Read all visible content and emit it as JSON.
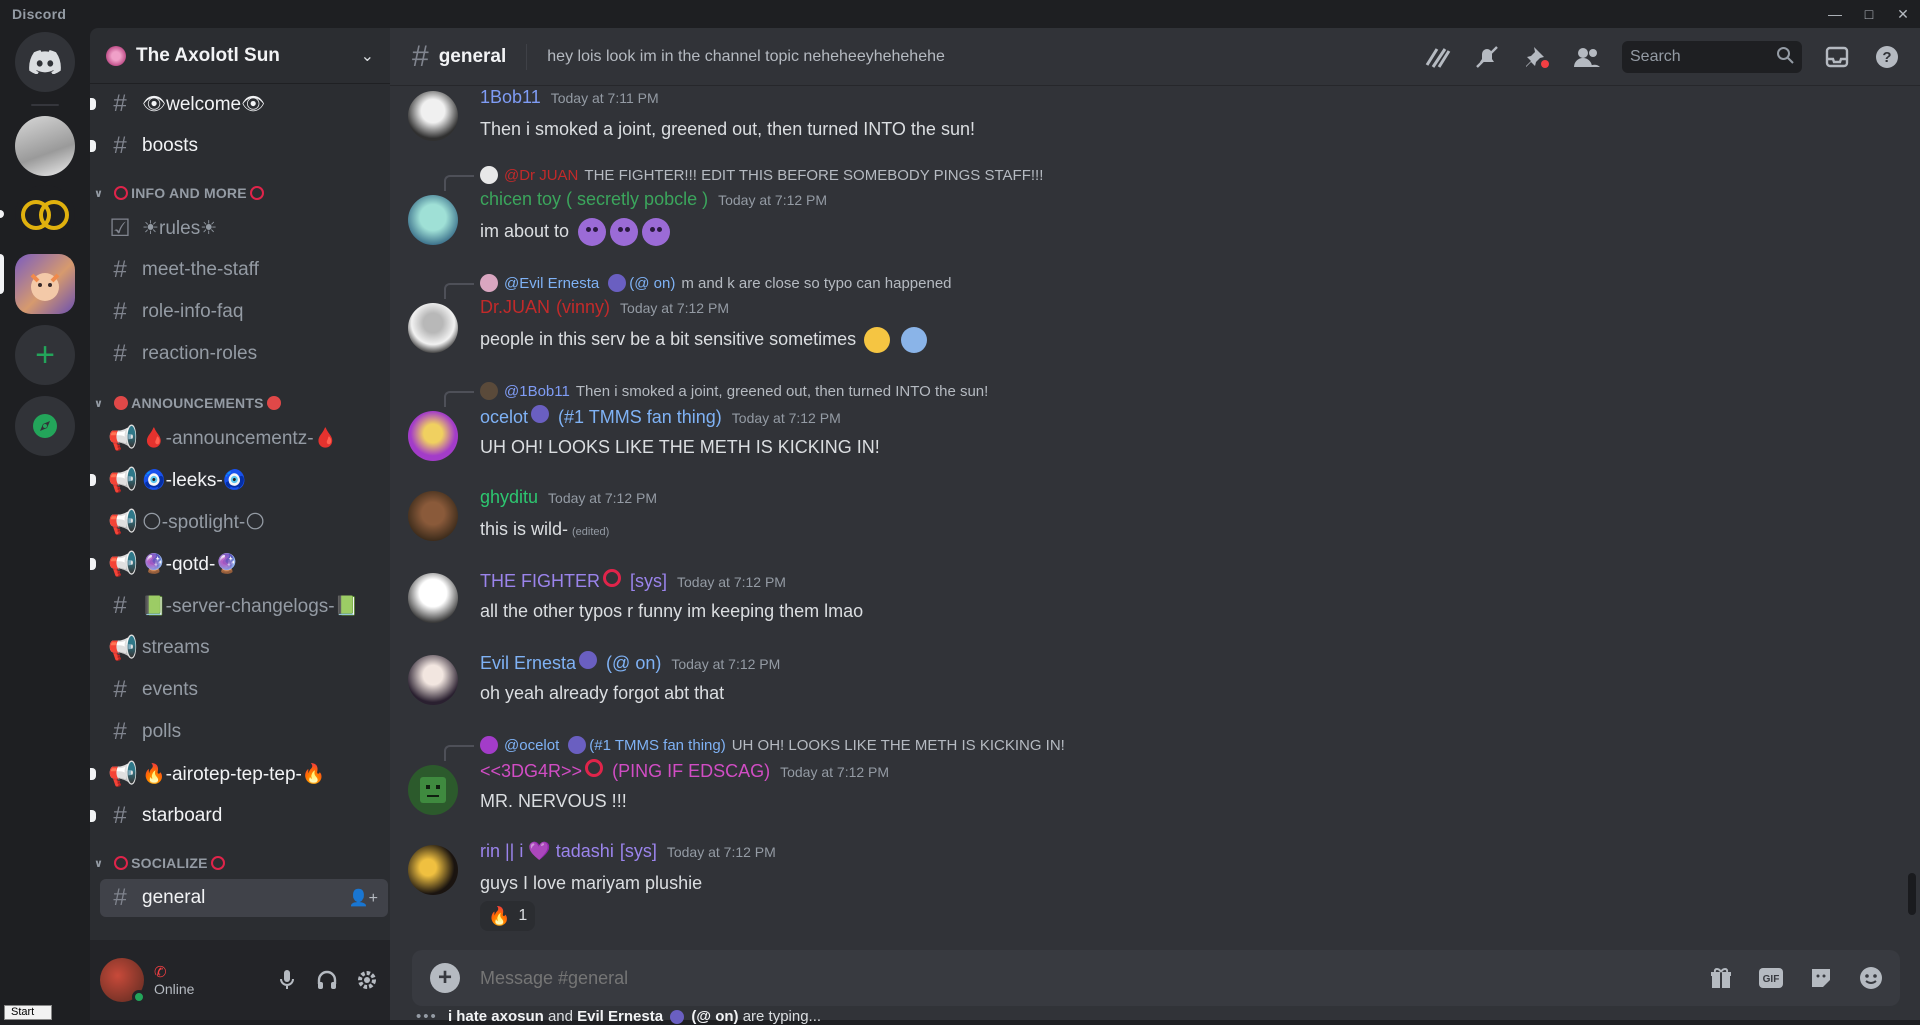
{
  "app": {
    "title": "Discord"
  },
  "guild": {
    "name": "The Axolotl Sun"
  },
  "sidebar": {
    "channels": [
      {
        "label": "👁welcome👁",
        "icon": "hash",
        "unread": true
      },
      {
        "label": "boosts",
        "icon": "hash",
        "unread": true
      }
    ],
    "cat_info": "INFO AND MORE",
    "info_channels": [
      {
        "label": "☀rules☀",
        "icon": "rules"
      },
      {
        "label": "meet-the-staff",
        "icon": "hash"
      },
      {
        "label": "role-info-faq",
        "icon": "hash"
      },
      {
        "label": "reaction-roles",
        "icon": "hash"
      }
    ],
    "cat_announcements": "ANNOUNCEMENTS",
    "ann_channels": [
      {
        "label": "🩸-announcementz-🩸",
        "icon": "megaphone"
      },
      {
        "label": "🧿-leeks-🧿",
        "icon": "megaphone",
        "unread": true
      },
      {
        "label": "🌕-spotlight-🌕",
        "icon": "megaphone"
      },
      {
        "label": "🔮-qotd-🔮",
        "icon": "megaphone",
        "unread": true
      },
      {
        "label": "📗-server-changelogs-📗",
        "icon": "hash"
      },
      {
        "label": "streams",
        "icon": "megaphone"
      },
      {
        "label": "events",
        "icon": "hash"
      },
      {
        "label": "polls",
        "icon": "hash"
      },
      {
        "label": "🔥-airotep-tep-tep-🔥",
        "icon": "megaphone",
        "unread": true
      },
      {
        "label": "starboard",
        "icon": "hash",
        "unread": true
      }
    ],
    "cat_socialize": "SOCIALIZE",
    "active_channel": "general",
    "user_status": "Online"
  },
  "header": {
    "channel": "general",
    "topic": "hey lois look im in the channel topic neheheeyhehehehe",
    "search_placeholder": "Search"
  },
  "messages": [
    {
      "user": "1Bob11",
      "color": "#7f9cf5",
      "tag": "",
      "time": "Today at 7:11 PM",
      "text": "Then i smoked a joint, greened out, then turned INTO the sun!"
    },
    {
      "reply_to": "@Dr JUAN",
      "reply_text": "THE FIGHTER!!! EDIT THIS BEFORE SOMEBODY PINGS STAFF!!!",
      "user": "chicen toy ( secretly pobcle )",
      "color": "#3ba55c",
      "tag": "",
      "time": "Today at 7:12 PM",
      "text": "im about to"
    },
    {
      "reply_to": "@Evil Ernesta",
      "reply_tag": "(@ on)",
      "reply_text": "m and k are close so typo can happened",
      "user": "Dr.JUAN",
      "color": "#c22a2a",
      "tag": "(vinny)",
      "time": "Today at 7:12 PM",
      "text": "people in this serv be a bit sensitive sometimes"
    },
    {
      "reply_to": "@1Bob11",
      "reply_text": "Then i smoked a joint, greened out, then turned INTO the sun!",
      "user": "ocelot",
      "color": "#7fb2f5",
      "tag": "(#1 TMMS fan thing)",
      "time": "Today at 7:12 PM",
      "text": "UH OH! LOOKS LIKE THE METH IS KICKING IN!"
    },
    {
      "user": "ghyditu",
      "color": "#2dc770",
      "tag": "",
      "time": "Today at 7:12 PM",
      "text": "this is wild-",
      "edited": "(edited)"
    },
    {
      "user": "THE FIGHTER",
      "color": "#9b84ec",
      "tag": "[sys]",
      "time": "Today at 7:12 PM",
      "text": "all the other typos r funny im keeping them lmao"
    },
    {
      "user": "Evil Ernesta",
      "color": "#7fb2f5",
      "tag": "(@ on)",
      "time": "Today at 7:12 PM",
      "text": "oh yeah already forgot abt that"
    },
    {
      "reply_to": "@ocelot",
      "reply_tag": "(#1 TMMS fan thing)",
      "reply_text": "UH OH! LOOKS LIKE THE METH IS KICKING IN!",
      "user": "<<3DG4R>>",
      "color": "#d14dc4",
      "tag": "(PING IF EDSCAG)",
      "time": "Today at 7:12 PM",
      "text": "MR. NERVOUS !!!"
    },
    {
      "user": "rin || i 💜 tadashi",
      "color": "#9b84ec",
      "tag": "[sys]",
      "time": "Today at 7:12 PM",
      "text": "guys I love mariyam plushie",
      "reaction_count": "1"
    }
  ],
  "composer": {
    "placeholder": "Message #general"
  },
  "typing": {
    "user1": "i hate axosun",
    "and": "and",
    "user2": "Evil Ernesta",
    "user2_tag": "(@ on)",
    "suffix": "are typing..."
  },
  "taskbar": {
    "start": "Start"
  }
}
